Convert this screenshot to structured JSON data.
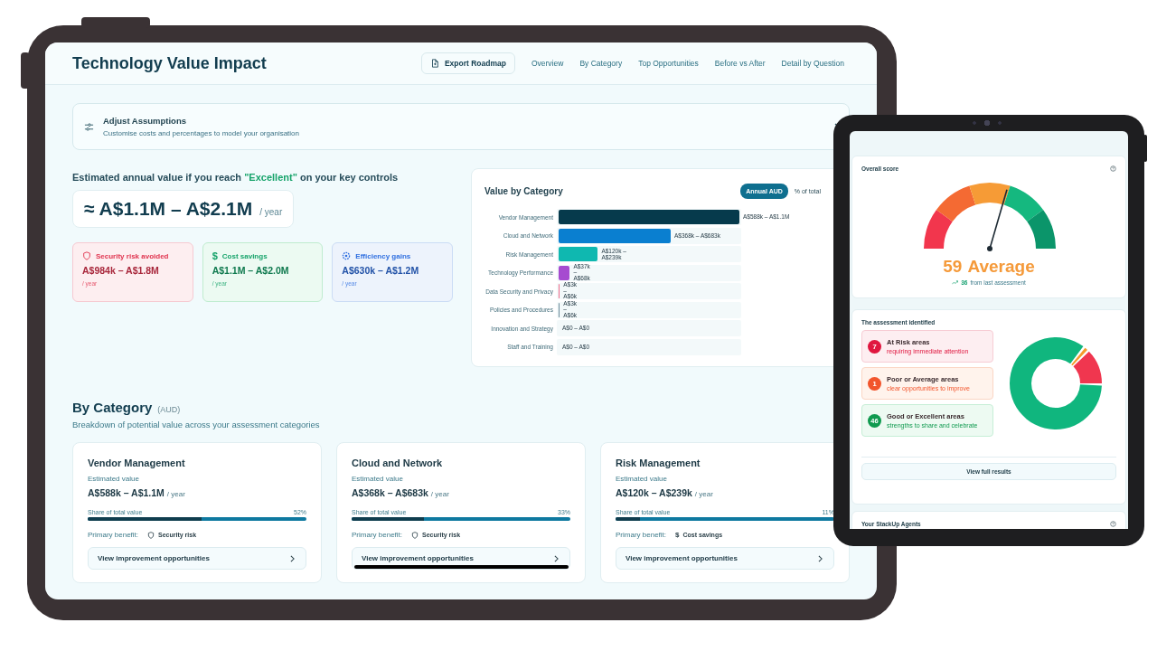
{
  "laptop": {
    "header": {
      "title": "Technology Value Impact",
      "export_button": "Export Roadmap",
      "nav": [
        "Overview",
        "By Category",
        "Top Opportunities",
        "Before vs After",
        "Detail by Question"
      ]
    },
    "assumptions": {
      "title": "Adjust Assumptions",
      "subtitle": "Customise costs and percentages to model your organisation"
    },
    "headline": {
      "lead": "Estimated annual value if you reach ",
      "highlight": "\"Excellent\"",
      "tail": " on your key controls"
    },
    "total": {
      "value": "≈ A$1.1M – A$2.1M",
      "unit": "/ year"
    },
    "benefits": [
      {
        "kind": "shield",
        "label": "Security risk avoided",
        "value": "A$984k – A$1.8M",
        "unit": "/ year",
        "color": "#e0344f"
      },
      {
        "kind": "dollar",
        "icon": "$",
        "label": "Cost savings",
        "value": "A$1.1M – A$2.0M",
        "unit": "/ year",
        "color": "#16a36a"
      },
      {
        "kind": "gear",
        "label": "Efficiency gains",
        "value": "A$630k – A$1.2M",
        "unit": "/ year",
        "color": "#2f6fe0"
      }
    ],
    "chart": {
      "title": "Value by Category",
      "toggle": [
        {
          "label": "Annual AUD",
          "selected": true
        },
        {
          "label": "% of total",
          "selected": false
        }
      ],
      "bars": [
        {
          "category": "Vendor Management",
          "value": "A$588k – A$1.1M",
          "level": 1,
          "color": "#063a4c"
        },
        {
          "category": "Cloud and Network",
          "value": "A$368k – A$683k",
          "level": 0.62,
          "color": "#0a7fd0"
        },
        {
          "category": "Risk Management",
          "value": "A$120k – A$239k",
          "level": 0.217,
          "color": "#0fb8b0"
        },
        {
          "category": "Technology Performance",
          "value": "A$37k – A$68k",
          "level": 0.062,
          "color": "#a64bd0"
        },
        {
          "category": "Data Security and Privacy",
          "value": "A$3k – A$6k",
          "level": 0.006,
          "color": "#f06b8a"
        },
        {
          "category": "Policies and Procedures",
          "value": "A$3k – A$6k",
          "level": 0.006,
          "color": "#6b8a99"
        },
        {
          "category": "Innovation and Strategy",
          "value": "A$0 – A$0",
          "level": 0
        },
        {
          "category": "Staff and Training",
          "value": "A$0 – A$0",
          "level": 0
        }
      ]
    },
    "section": {
      "title": "By Category",
      "unit": "(AUD)",
      "subtitle": "Breakdown of potential value across your assessment categories"
    },
    "cards": [
      {
        "title": "Vendor Management",
        "est_label": "Estimated value",
        "value": "A$588k – A$1.1M",
        "unit": "/ year",
        "share_label": "Share of total value",
        "share": "52%",
        "level": 0.52,
        "benefit_label": "Primary benefit:",
        "benefit": {
          "kind": "shield",
          "text": "Security risk"
        },
        "button": "View improvement opportunities",
        "struck": false
      },
      {
        "title": "Cloud and Network",
        "est_label": "Estimated value",
        "value": "A$368k – A$683k",
        "unit": "/ year",
        "share_label": "Share of total value",
        "share": "33%",
        "level": 0.33,
        "benefit_label": "Primary benefit:",
        "benefit": {
          "kind": "shield",
          "text": "Security risk"
        },
        "button": "View improvement opportunities",
        "struck": true
      },
      {
        "title": "Risk Management",
        "est_label": "Estimated value",
        "value": "A$120k – A$239k",
        "unit": "/ year",
        "share_label": "Share of total value",
        "share": "11%",
        "level": 0.11,
        "benefit_label": "Primary benefit:",
        "benefit": {
          "kind": "dollar",
          "icon": "$",
          "text": "Cost savings"
        },
        "button": "View improvement opportunities",
        "struck": false
      }
    ]
  },
  "tablet": {
    "overall": {
      "title": "Overall score",
      "score": "59",
      "rating": "Average",
      "level": 0.59,
      "change": "36",
      "change_text": "from last assessment"
    },
    "assessment": {
      "title": "The assessment identified",
      "items": [
        {
          "count": "7",
          "title": "At Risk areas",
          "subtitle": "requiring immediate attention",
          "color": "#e0163f"
        },
        {
          "count": "1",
          "title": "Poor or Average areas",
          "subtitle": "clear opportunities to improve",
          "color": "#f2552c"
        },
        {
          "count": "46",
          "title": "Good or Excellent areas",
          "subtitle": "strengths to share and celebrate",
          "color": "#0f9a4f"
        }
      ],
      "button": "View full results"
    },
    "agents": {
      "title": "Your StackUp Agents"
    }
  }
}
